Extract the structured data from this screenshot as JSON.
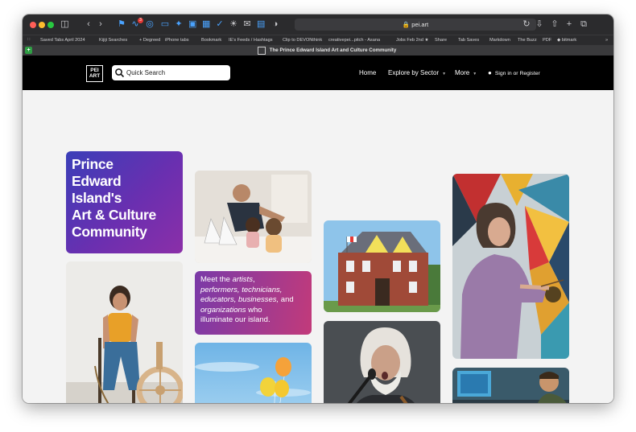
{
  "browser": {
    "url": "pei.art",
    "notification_badge": "3",
    "bookmarks": [
      "Saved Tabs April 2024",
      "Kijiji Searches",
      "+ Degreed",
      "iPhone tabs",
      "Bookmark",
      "IE's Feeds / Hashtags",
      "Clip to DEVONthink",
      "creativepei...pitch - Asana",
      "Jobs Feb 2nd ★",
      "Share",
      "Tab Saves",
      "Markdown",
      "The Buzz",
      "PDF",
      "◆ bitmark"
    ],
    "tab_title": "The Prince Edward Island Art and Culture Community"
  },
  "nav": {
    "logo_top": "PEI",
    "logo_bottom": "ART",
    "search_placeholder": "Quick Search",
    "home": "Home",
    "explore": "Explore by Sector",
    "more": "More",
    "signin": "Sign in or Register"
  },
  "hero": {
    "title_lines": [
      "Prince",
      "Edward",
      "Island's",
      "Art & Culture",
      "Community"
    ]
  },
  "meet": {
    "w1": "Meet the ",
    "w2": "artists",
    "w3": ",",
    "w4": "performers, technicians,",
    "w5": "educators, businesses,",
    "w6": " and",
    "w7": "organizations",
    "w8": " who",
    "w9": "illuminate our island."
  },
  "colors": {
    "nav_bg": "#000000",
    "hero_gradient_start": "#3a3fb8",
    "hero_gradient_end": "#8b2fa8",
    "meet_gradient_start": "#7a3aa8",
    "meet_gradient_end": "#c23a7a"
  }
}
